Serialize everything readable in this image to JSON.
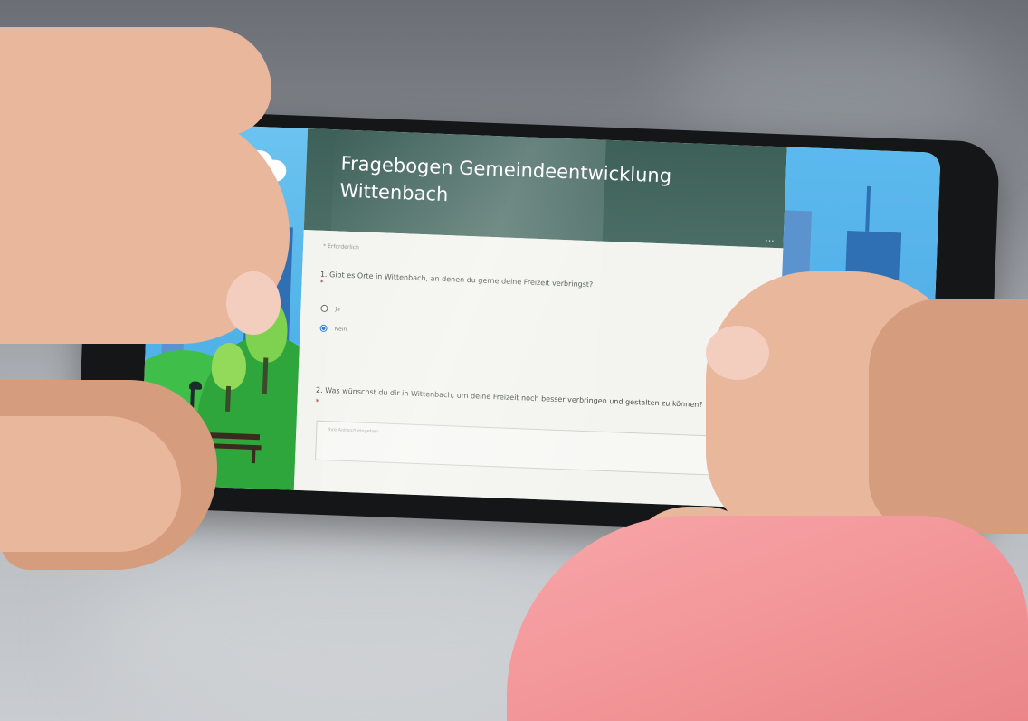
{
  "form": {
    "title_line1": "Fragebogen Gemeindeentwicklung",
    "title_line2": "Wittenbach",
    "menu": "...",
    "required_note": "* Erforderlich",
    "question1": {
      "text": "1. Gibt es Orte in Wittenbach, an denen du gerne deine Freizeit verbringst?",
      "asterisk": "*",
      "options": [
        {
          "label": "Ja",
          "selected": false
        },
        {
          "label": "Nein",
          "selected": true
        }
      ]
    },
    "question2": {
      "text": "2. Was wünschst du dir in Wittenbach, um deine Freizeit noch besser verbringen und gestalten zu können?",
      "asterisk": "*",
      "placeholder": "Ihre Antwort eingeben"
    }
  },
  "colors": {
    "header": "#3d6059",
    "body": "#f3f4ef",
    "sky": "#4fb2e8",
    "grass": "#3fbf4a",
    "radio_selected": "#2f7fd9",
    "sleeve": "#f29497"
  }
}
